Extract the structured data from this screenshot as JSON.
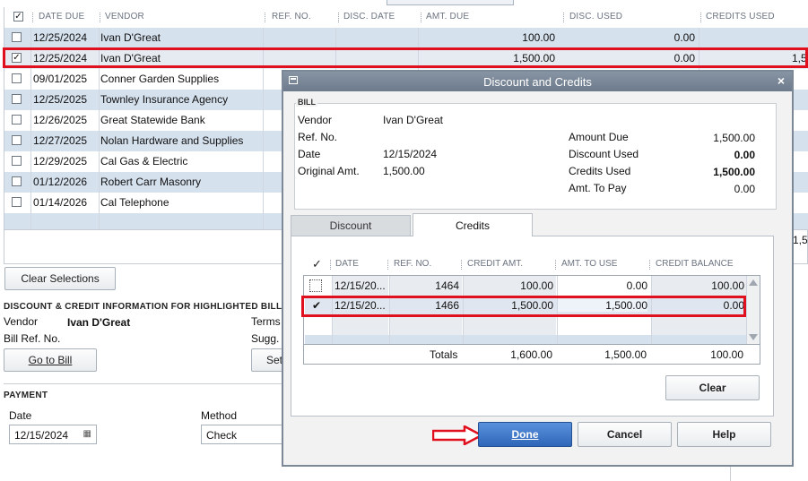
{
  "bills_grid": {
    "columns": [
      "DATE DUE",
      "VENDOR",
      "REF. NO.",
      "DISC. DATE",
      "AMT. DUE",
      "DISC. USED",
      "CREDITS USED"
    ],
    "rows": [
      {
        "checked": false,
        "date_due": "12/25/2024",
        "vendor": "Ivan D'Great",
        "amt_due": "100.00",
        "disc_used": "0.00",
        "credits_used": ""
      },
      {
        "checked": true,
        "date_due": "12/25/2024",
        "vendor": "Ivan D'Great",
        "amt_due": "1,500.00",
        "disc_used": "0.00",
        "credits_used": "1,5"
      },
      {
        "checked": false,
        "date_due": "09/01/2025",
        "vendor": "Conner Garden Supplies"
      },
      {
        "checked": false,
        "date_due": "12/25/2025",
        "vendor": "Townley Insurance Agency"
      },
      {
        "checked": false,
        "date_due": "12/26/2025",
        "vendor": "Great Statewide Bank"
      },
      {
        "checked": false,
        "date_due": "12/27/2025",
        "vendor": "Nolan Hardware and Supplies"
      },
      {
        "checked": false,
        "date_due": "12/29/2025",
        "vendor": "Cal Gas & Electric"
      },
      {
        "checked": false,
        "date_due": "01/12/2026",
        "vendor": "Robert Carr Masonry"
      },
      {
        "checked": false,
        "date_due": "01/14/2026",
        "vendor": "Cal Telephone"
      }
    ],
    "total_partial": "1,5"
  },
  "clear_selections_label": "Clear Selections",
  "discount_info": {
    "title": "DISCOUNT & CREDIT INFORMATION FOR HIGHLIGHTED BILL",
    "vendor_label": "Vendor",
    "vendor_value": "Ivan D'Great",
    "bill_ref_label": "Bill Ref. No.",
    "terms_label": "Terms",
    "sugg_label": "Sugg.",
    "go_to_bill_label": "Go to Bill",
    "set_label": "Set"
  },
  "payment": {
    "title": "PAYMENT",
    "date_label": "Date",
    "date_value": "12/15/2024",
    "method_label": "Method",
    "method_value": "Check"
  },
  "dialog": {
    "title": "Discount and Credits",
    "bill_caption": "BILL",
    "vendor_label": "Vendor",
    "vendor_value": "Ivan D'Great",
    "ref_label": "Ref. No.",
    "date_label": "Date",
    "date_value": "12/15/2024",
    "orig_amt_label": "Original Amt.",
    "orig_amt_value": "1,500.00",
    "amount_due_label": "Amount Due",
    "amount_due_value": "1,500.00",
    "discount_used_label": "Discount Used",
    "discount_used_value": "0.00",
    "credits_used_label": "Credits Used",
    "credits_used_value": "1,500.00",
    "amt_to_pay_label": "Amt. To Pay",
    "amt_to_pay_value": "0.00",
    "tabs": [
      "Discount",
      "Credits"
    ],
    "credits_columns": [
      "✓",
      "DATE",
      "REF. NO.",
      "CREDIT AMT.",
      "AMT. TO USE",
      "CREDIT BALANCE"
    ],
    "credits_rows": [
      {
        "checked": false,
        "date": "12/15/20...",
        "ref": "1464",
        "credit_amt": "100.00",
        "amt_to_use": "0.00",
        "balance": "100.00"
      },
      {
        "checked": true,
        "date": "12/15/20...",
        "ref": "1466",
        "credit_amt": "1,500.00",
        "amt_to_use": "1,500.00",
        "balance": "0.00"
      }
    ],
    "totals_label": "Totals",
    "totals_credit_amt": "1,600.00",
    "totals_amt_to_use": "1,500.00",
    "totals_balance": "100.00",
    "clear_label": "Clear",
    "done_label": "Done",
    "cancel_label": "Cancel",
    "help_label": "Help"
  },
  "colors": {
    "highlight": "#e0101f",
    "row_band": "#d6e1ee",
    "done_button": "#3f78c8"
  }
}
